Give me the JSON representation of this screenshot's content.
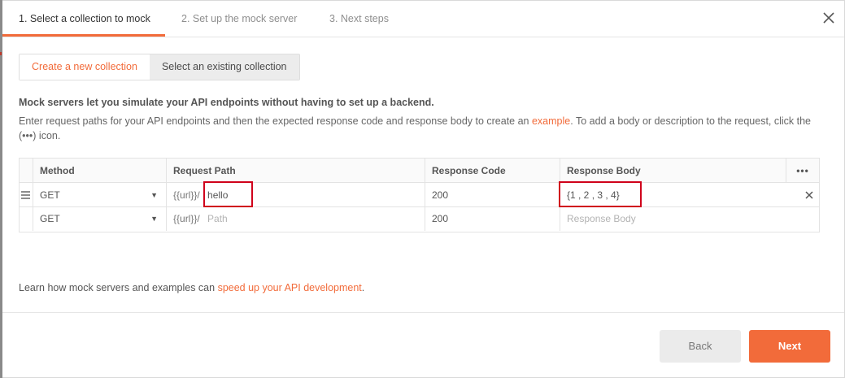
{
  "steps": [
    {
      "label": "1. Select a collection to mock"
    },
    {
      "label": "2. Set up the mock server"
    },
    {
      "label": "3. Next steps"
    }
  ],
  "tabs": {
    "create_label": "Create a new collection",
    "existing_label": "Select an existing collection"
  },
  "intro": {
    "bold": "Mock servers let you simulate your API endpoints without having to set up a backend.",
    "text_before": "Enter request paths for your API endpoints and then the expected response code and response body to create an ",
    "link": "example",
    "text_after": ". To add a body or description to the request, click the (•••) icon."
  },
  "table": {
    "headers": {
      "method": "Method",
      "path": "Request Path",
      "code": "Response Code",
      "body": "Response Body"
    },
    "more_icon": "•••",
    "rows": [
      {
        "method": "GET",
        "prefix": "{{url}}/",
        "path": "hello",
        "code": "200",
        "body": "{1 , 2 , 3 , 4}"
      },
      {
        "method": "GET",
        "prefix": "{{url}}/",
        "path_placeholder": "Path",
        "code": "200",
        "body_placeholder": "Response Body"
      }
    ]
  },
  "footer": {
    "text": "Learn how mock servers and examples can ",
    "link": "speed up your API development",
    "end": "."
  },
  "buttons": {
    "back": "Back",
    "next": "Next"
  },
  "colors": {
    "accent": "#f26b3a",
    "highlight_box": "#d0021b"
  }
}
